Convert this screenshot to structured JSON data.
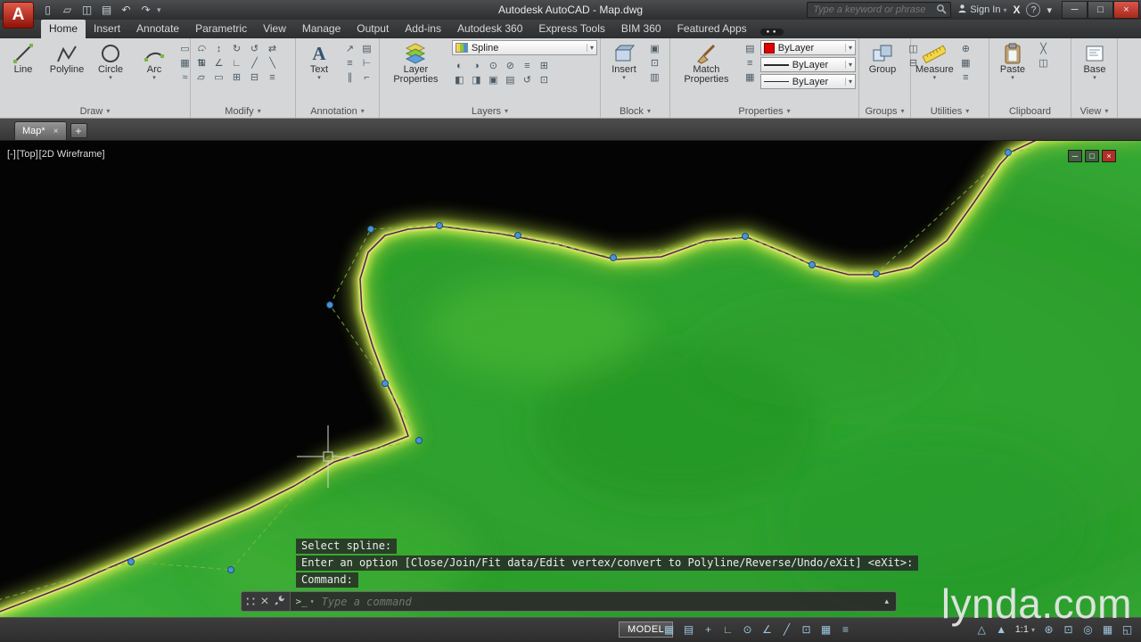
{
  "titlebar": {
    "title": "Autodesk AutoCAD - Map.dwg",
    "search_placeholder": "Type a keyword or phrase",
    "sign_in_label": "Sign In"
  },
  "ribbon": {
    "tabs": [
      "Home",
      "Insert",
      "Annotate",
      "Parametric",
      "View",
      "Manage",
      "Output",
      "Add-ins",
      "Autodesk 360",
      "Express Tools",
      "BIM 360",
      "Featured Apps"
    ],
    "active_tab": "Home",
    "panels": {
      "draw": {
        "label": "Draw",
        "buttons": [
          "Line",
          "Polyline",
          "Circle",
          "Arc"
        ],
        "minis": [
          "▭",
          "◠",
          "▦",
          "⊞",
          "≈",
          "◌"
        ]
      },
      "modify": {
        "label": "Modify",
        "minis": [
          "↔",
          "↕",
          "↻",
          "↺",
          "⇄",
          "⇅",
          "∠",
          "∟",
          "╱",
          "╲",
          "▱",
          "▭",
          "⊞",
          "⊟",
          "≡"
        ]
      },
      "annotation": {
        "label": "Annotation",
        "buttons": [
          "Text"
        ],
        "minis": [
          "↗",
          "▤",
          "≡",
          "⊢",
          "∥",
          "⌐"
        ]
      },
      "layers": {
        "label": "Layers",
        "buttons": [
          "Layer Properties"
        ],
        "layer_value": "Spline",
        "minis": [
          "◐",
          "◑",
          "⊙",
          "⊘",
          "≡",
          "⊞",
          "◧",
          "◨",
          "▣",
          "▤",
          "↺",
          "⊡"
        ]
      },
      "block": {
        "label": "Block",
        "buttons": [
          "Insert"
        ],
        "minis": [
          "▣",
          "⊡",
          "▥"
        ]
      },
      "properties": {
        "label": "Properties",
        "buttons": [
          "Match Properties"
        ],
        "values": [
          "ByLayer",
          "ByLayer",
          "ByLayer"
        ],
        "minis": [
          "▤",
          "≡",
          "▦"
        ]
      },
      "groups": {
        "label": "Groups",
        "buttons": [
          "Group"
        ],
        "minis": [
          "◫",
          "⊟"
        ]
      },
      "utilities": {
        "label": "Utilities",
        "buttons": [
          "Measure"
        ],
        "minis": [
          "⊕",
          "▦",
          "≡"
        ]
      },
      "clipboard": {
        "label": "Clipboard",
        "buttons": [
          "Paste"
        ],
        "minis": [
          "╳",
          "◫"
        ]
      },
      "view": {
        "label": "View",
        "buttons": [
          "Base"
        ]
      }
    }
  },
  "document_tabs": {
    "active_tab": "Map*"
  },
  "viewport": {
    "controls": [
      "[-]",
      "[Top]",
      "[2D Wireframe]"
    ]
  },
  "command": {
    "history": [
      "Select spline:",
      "Enter an option [Close/Join/Fit data/Edit vertex/convert to Polyline/Reverse/Undo/eXit] <eXit>:",
      "Command:"
    ],
    "placeholder": "Type a command"
  },
  "statusbar": {
    "model_label": "MODEL",
    "scale_label": "1:1",
    "left_icons": [
      "▦",
      "▤",
      "+",
      "∟",
      "⊙",
      "∠",
      "╱",
      "⊡",
      "▦",
      "≡"
    ],
    "right_icons_a": [
      "△",
      "▲"
    ],
    "right_icons_b": [
      "⊛",
      "⊡",
      "◎",
      "▦",
      "◱"
    ]
  },
  "watermark": "lynda.com",
  "icons": {
    "qat": [
      "▯",
      "▱",
      "◫",
      "▤",
      "↶",
      "↷"
    ],
    "caret": "▾",
    "win_min": "─",
    "win_max": "□",
    "win_close": "×",
    "vp_min": "─",
    "vp_max": "□",
    "vp_close": "×",
    "exchange": "X",
    "help": "?",
    "dots": "● ●",
    "cmd_grip": "∷",
    "cmd_close": "×",
    "cmd_prompt": ">_",
    "cmd_up": "▴",
    "tab_close": "×",
    "tab_plus": "+"
  },
  "colors": {
    "land_green": "#2fa12f",
    "coast_glow": "#d8ee55",
    "spline": "#5c2450",
    "cv_blue": "#4a93d5",
    "accent_red": "#c01010"
  }
}
